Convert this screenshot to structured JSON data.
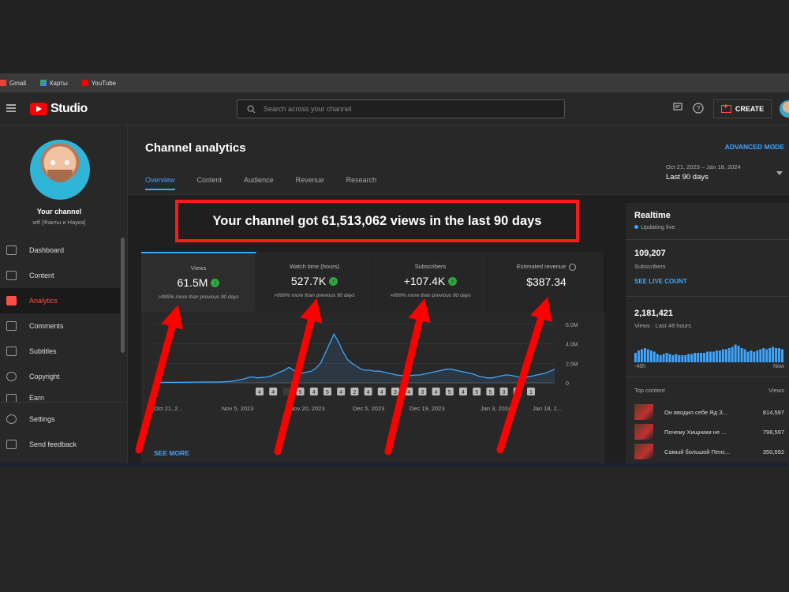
{
  "bookmarks": [
    {
      "label": "Gmail",
      "icon": "gmail-icon"
    },
    {
      "label": "Карты",
      "icon": "maps-icon"
    },
    {
      "label": "YouTube",
      "icon": "youtube-icon"
    }
  ],
  "header": {
    "logo_text": "Studio",
    "search_placeholder": "Search across your channel",
    "create_label": "CREATE"
  },
  "sidebar": {
    "channel_title": "Your channel",
    "channel_name": "wtf [Факты и Наука]",
    "items": [
      {
        "label": "Dashboard",
        "icon": "dashboard-icon",
        "active": false
      },
      {
        "label": "Content",
        "icon": "content-icon",
        "active": false
      },
      {
        "label": "Analytics",
        "icon": "analytics-icon",
        "active": true
      },
      {
        "label": "Comments",
        "icon": "comments-icon",
        "active": false
      },
      {
        "label": "Subtitles",
        "icon": "subtitles-icon",
        "active": false
      },
      {
        "label": "Copyright",
        "icon": "copyright-icon",
        "active": false
      },
      {
        "label": "Earn",
        "icon": "earn-icon",
        "active": false
      }
    ],
    "bottom_items": [
      {
        "label": "Settings",
        "icon": "gear-icon"
      },
      {
        "label": "Send feedback",
        "icon": "feedback-icon"
      }
    ]
  },
  "main": {
    "title": "Channel analytics",
    "advanced_mode": "ADVANCED MODE",
    "tabs": [
      "Overview",
      "Content",
      "Audience",
      "Revenue",
      "Research"
    ],
    "date_range": "Oct 21, 2023 – Jan 18, 2024",
    "date_label": "Last 90 days",
    "headline": "Your channel got 61,513,062 views in the last 90 days",
    "metrics": [
      {
        "label": "Views",
        "value": "61.5M",
        "up": true,
        "compare": ">999% more than previous 90 days"
      },
      {
        "label": "Watch time (hours)",
        "value": "527.7K",
        "up": true,
        "compare": ">999% more than previous 90 days"
      },
      {
        "label": "Subscribers",
        "value": "+107.4K",
        "up": true,
        "compare": ">999% more than previous 90 days"
      },
      {
        "label": "Estimated revenue",
        "value": "$387.34",
        "up": false,
        "compare": ""
      }
    ],
    "see_more": "SEE MORE"
  },
  "chart_data": {
    "type": "area",
    "x_tick_labels": [
      "Oct 21, 2...",
      "Nov 5, 2023",
      "Nov 20, 2023",
      "Dec 5, 2023",
      "Dec 19, 2023",
      "Jan 3, 2024",
      "Jan 18, 2..."
    ],
    "y_tick_labels": [
      "6.0M",
      "4.0M",
      "2.0M",
      "0"
    ],
    "ylim": [
      0,
      6000000
    ],
    "values": [
      0.05,
      0.05,
      0.05,
      0.05,
      0.05,
      0.05,
      0.06,
      0.06,
      0.07,
      0.07,
      0.08,
      0.08,
      0.08,
      0.09,
      0.09,
      0.1,
      0.12,
      0.15,
      0.2,
      0.3,
      0.4,
      0.55,
      0.6,
      0.5,
      0.55,
      0.6,
      0.7,
      0.9,
      1.1,
      1.3,
      1.6,
      1.3,
      1.1,
      1.0,
      1.1,
      1.2,
      1.5,
      2.0,
      3.0,
      4.0,
      5.0,
      4.2,
      3.2,
      2.4,
      2.0,
      1.7,
      1.4,
      1.3,
      1.3,
      1.2,
      1.2,
      1.1,
      1.0,
      0.9,
      0.8,
      0.75,
      0.7,
      0.75,
      0.8,
      0.8,
      0.9,
      1.0,
      1.1,
      1.2,
      1.3,
      1.4,
      1.4,
      1.3,
      1.2,
      1.1,
      1.0,
      0.9,
      0.7,
      0.6,
      0.5,
      0.5,
      0.6,
      0.7,
      0.8,
      0.8,
      0.7,
      0.6,
      0.6,
      0.6,
      0.7,
      0.8,
      0.9,
      1.0,
      1.2,
      1.4
    ],
    "markers": [
      "4",
      "4",
      "",
      "5",
      "4",
      "5",
      "4",
      "2",
      "4",
      "4",
      "3",
      "4",
      "3",
      "4",
      "5",
      "4",
      "5",
      "5",
      "3",
      "3",
      "1"
    ]
  },
  "realtime": {
    "title": "Realtime",
    "status": "Updating live",
    "subscribers_value": "109,207",
    "subscribers_label": "Subscribers",
    "live_count_link": "SEE LIVE COUNT",
    "views_value": "2,181,421",
    "views_label": "Views · Last 48 hours",
    "axis_start": "-48h",
    "axis_end": "Now",
    "bars": [
      0.4,
      0.5,
      0.55,
      0.6,
      0.55,
      0.5,
      0.45,
      0.35,
      0.3,
      0.35,
      0.4,
      0.35,
      0.3,
      0.35,
      0.3,
      0.3,
      0.3,
      0.35,
      0.35,
      0.4,
      0.4,
      0.4,
      0.4,
      0.45,
      0.45,
      0.45,
      0.5,
      0.5,
      0.55,
      0.55,
      0.6,
      0.65,
      0.75,
      0.7,
      0.6,
      0.55,
      0.45,
      0.5,
      0.45,
      0.5,
      0.55,
      0.6,
      0.55,
      0.6,
      0.65,
      0.6,
      0.6,
      0.55
    ],
    "top_content_label": "Top content",
    "views_col_label": "Views",
    "top_content": [
      {
        "title": "Он вводил себе Яд З...",
        "views": "814,597"
      },
      {
        "title": "Почему Хищники не ...",
        "views": "798,597"
      },
      {
        "title": "Самый большой Пенс...",
        "views": "350,692"
      }
    ]
  },
  "colors": {
    "accent_blue": "#3ea6ff",
    "highlight_red": "#ff1a1a",
    "up_green": "#2ba640",
    "youtube_red": "#ff0000"
  }
}
